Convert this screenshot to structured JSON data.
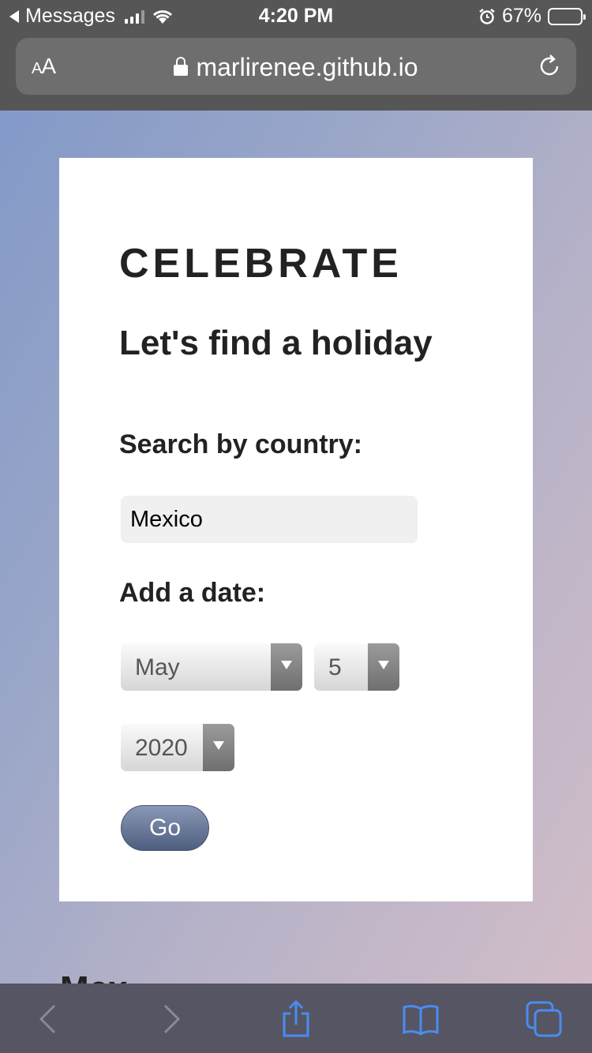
{
  "status_bar": {
    "back_app": "Messages",
    "time": "4:20 PM",
    "battery": "67%",
    "battery_level": 0.67
  },
  "browser": {
    "text_size_button": "AA",
    "url": "marlirenee.github.io"
  },
  "page": {
    "brand": "CELEBRATE",
    "headline": "Let's find a holiday",
    "country_label": "Search by country:",
    "country_value": "Mexico",
    "date_label": "Add a date:",
    "month_value": "May",
    "day_value": "5",
    "year_value": "2020",
    "go_label": "Go",
    "peek_text": "Mex"
  },
  "toolbar": {
    "icons": [
      "back-icon",
      "forward-icon",
      "share-icon",
      "bookmarks-icon",
      "tabs-icon"
    ]
  },
  "colors": {
    "chrome": "#565656",
    "toolbar": "#555563",
    "accent": "#5f6f92"
  }
}
